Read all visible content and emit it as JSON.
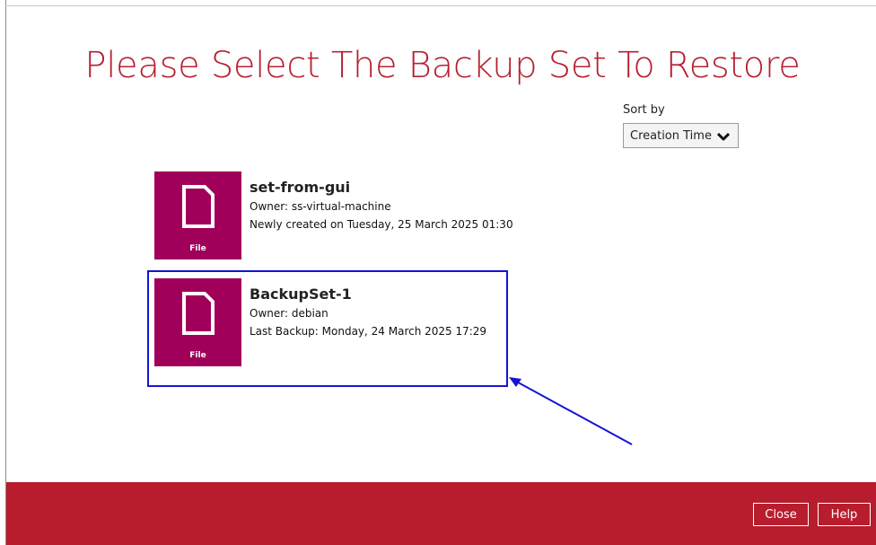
{
  "page": {
    "title": "Please Select The Backup Set To Restore"
  },
  "sort": {
    "label": "Sort by",
    "selected": "Creation Time",
    "icon": "chevron-down-icon"
  },
  "backup_sets": [
    {
      "name": "set-from-gui",
      "owner": "Owner: ss-virtual-machine",
      "status": "Newly created on Tuesday, 25 March 2025 01:30",
      "tile_label": "File",
      "icon": "file-icon"
    },
    {
      "name": "BackupSet-1",
      "owner": "Owner: debian",
      "status": "Last Backup: Monday, 24 March 2025 17:29",
      "tile_label": "File",
      "icon": "file-icon",
      "highlighted": true
    }
  ],
  "footer": {
    "close_label": "Close",
    "help_label": "Help"
  },
  "colors": {
    "title": "#b62030",
    "tile": "#a0005a",
    "footer": "#b81d2e",
    "highlight": "#1414d6"
  }
}
